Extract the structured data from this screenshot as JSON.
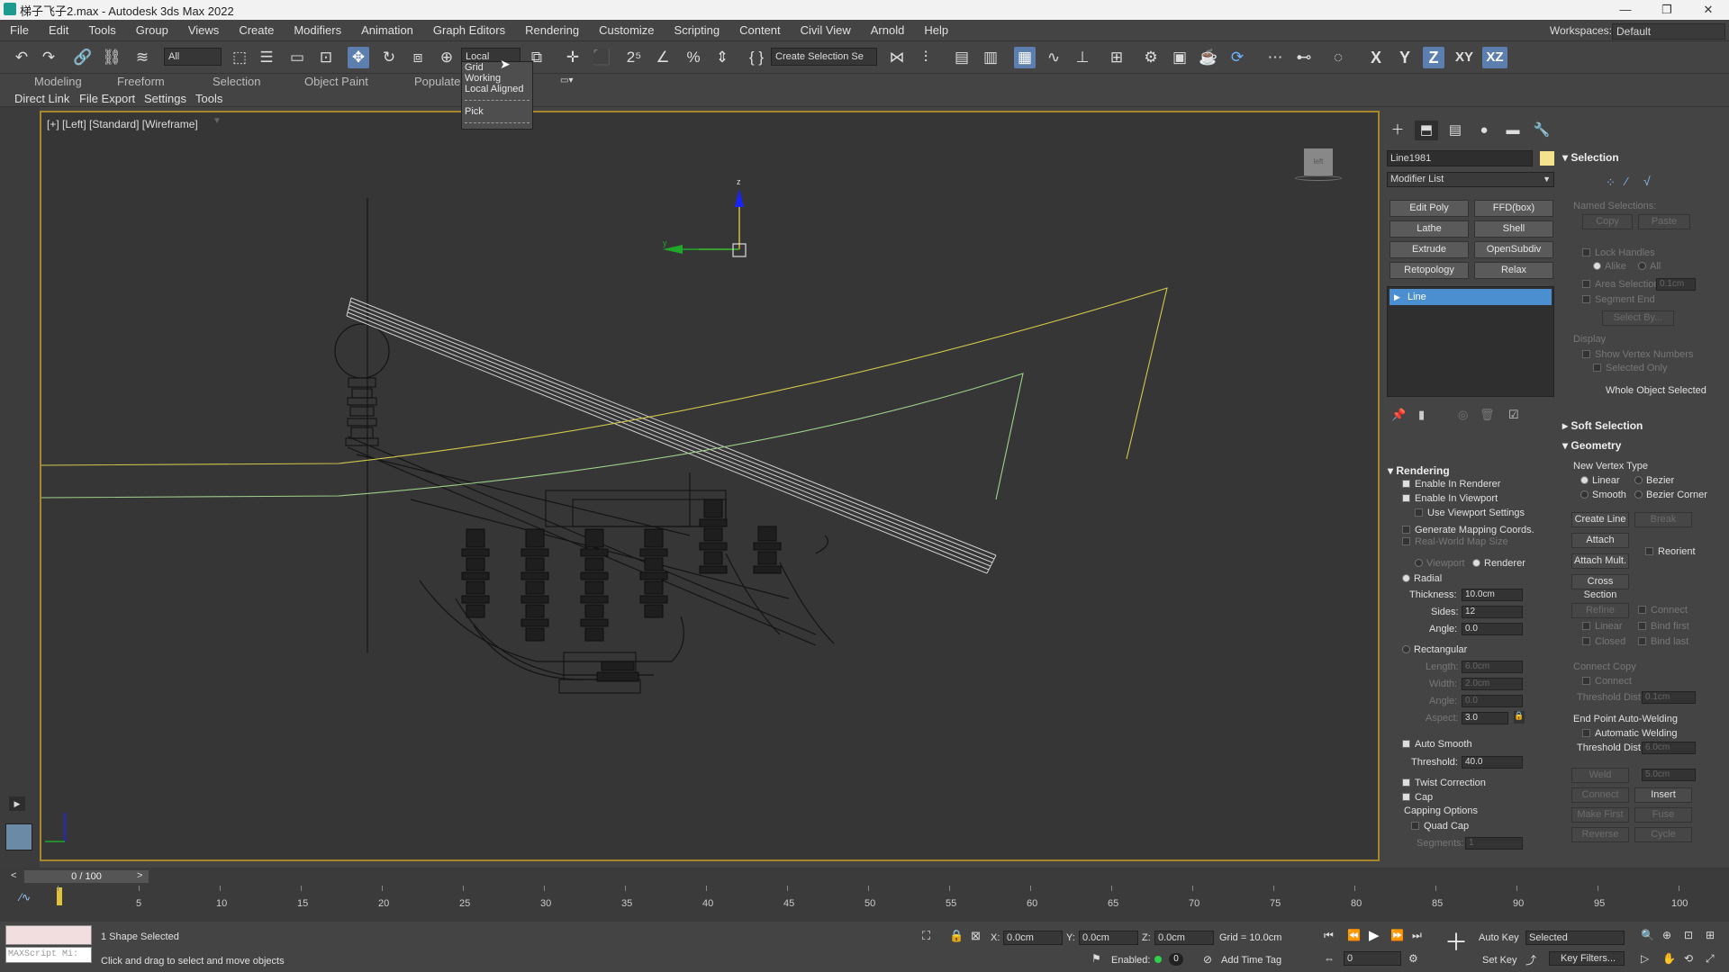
{
  "window": {
    "title": "梯子飞子2.max - Autodesk 3ds Max 2022",
    "minimize": "—",
    "restore": "❐",
    "close": "✕"
  },
  "menu": [
    "File",
    "Edit",
    "Tools",
    "Group",
    "Views",
    "Create",
    "Modifiers",
    "Animation",
    "Graph Editors",
    "Rendering",
    "Customize",
    "Scripting",
    "Content",
    "Civil View",
    "Arnold",
    "Help"
  ],
  "workspace": {
    "label": "Workspaces:",
    "value": "Default"
  },
  "toolbar": {
    "filter": "All",
    "coord_system": "Local",
    "selection_set": "Create Selection Se",
    "axis_x": "X",
    "axis_y": "Y",
    "axis_z": "Z",
    "axis_xy": "XY",
    "axis_xz": "XZ"
  },
  "coord_dropdown": [
    "Grid",
    "Working",
    "Local Aligned",
    "Pick"
  ],
  "ribbon": [
    "Modeling",
    "Freeform",
    "Selection",
    "Object Paint",
    "Populate"
  ],
  "subbar": [
    "Direct Link",
    "File Export",
    "Settings",
    "Tools"
  ],
  "viewport": {
    "label": "[+] [Left] [Standard] [Wireframe]",
    "cube": "left",
    "axis_z": "z",
    "axis_y": "y"
  },
  "command_panel": {
    "object_name": "Line1981",
    "object_color": "#f5e28c",
    "modifier_list": "Modifier List",
    "modifier_buttons": [
      "Edit Poly",
      "FFD(box)",
      "Lathe",
      "Shell",
      "Extrude",
      "OpenSubdiv",
      "Retopology",
      "Relax"
    ],
    "stack_item": "Line",
    "rendering": {
      "title": "Rendering",
      "enable_renderer": "Enable In Renderer",
      "enable_viewport": "Enable In Viewport",
      "use_viewport": "Use Viewport Settings",
      "gen_mapping": "Generate Mapping Coords.",
      "real_world": "Real-World Map Size",
      "viewport": "Viewport",
      "renderer": "Renderer",
      "radial": "Radial",
      "thickness_label": "Thickness:",
      "thickness": "10.0cm",
      "sides_label": "Sides:",
      "sides": "12",
      "angle_label": "Angle:",
      "angle": "0.0",
      "rectangular": "Rectangular",
      "length_label": "Length:",
      "length": "6.0cm",
      "width_label": "Width:",
      "width": "2.0cm",
      "angle2_label": "Angle:",
      "angle2": "0.0",
      "aspect_label": "Aspect:",
      "aspect": "3.0",
      "auto_smooth": "Auto Smooth",
      "threshold_label": "Threshold:",
      "threshold": "40.0",
      "twist": "Twist Correction",
      "cap": "Cap",
      "capping": "Capping Options",
      "quad_cap": "Quad Cap",
      "segments_label": "Segments:",
      "segments": "1"
    },
    "selection": {
      "title": "Selection",
      "named": "Named Selections:",
      "copy": "Copy",
      "paste": "Paste",
      "lock_handles": "Lock Handles",
      "alike": "Alike",
      "all": "All",
      "area_selection": "Area Selection",
      "area_value": "0.1cm",
      "segment_end": "Segment End",
      "select_by": "Select By...",
      "display": "Display",
      "show_vertex": "Show Vertex Numbers",
      "selected_only": "Selected Only",
      "status": "Whole Object Selected"
    },
    "soft_selection": "Soft Selection",
    "geometry": {
      "title": "Geometry",
      "new_vertex": "New Vertex Type",
      "linear": "Linear",
      "bezier": "Bezier",
      "smooth": "Smooth",
      "bezier_corner": "Bezier Corner",
      "create_line": "Create Line",
      "break": "Break",
      "attach": "Attach",
      "reorient": "Reorient",
      "attach_mult": "Attach Mult.",
      "cross_section": "Cross Section",
      "refine": "Refine",
      "connect": "Connect",
      "linear2": "Linear",
      "bind_first": "Bind first",
      "closed": "Closed",
      "bind_last": "Bind last",
      "connect_copy": "Connect Copy",
      "connect2": "Connect",
      "threshold_dist": "Threshold Dist",
      "threshold_val": "0.1cm",
      "end_point": "End Point Auto-Welding",
      "auto_weld": "Automatic Welding",
      "threshold_dist2": "Threshold Dist",
      "threshold_val2": "6.0cm",
      "weld": "Weld",
      "weld_val": "5.0cm",
      "connect3": "Connect",
      "insert": "Insert",
      "make_first": "Make First",
      "fuse": "Fuse",
      "reverse": "Reverse",
      "cycle": "Cycle"
    }
  },
  "timeline": {
    "slider": "0 / 100",
    "ticks": [
      "5",
      "10",
      "15",
      "20",
      "25",
      "30",
      "35",
      "40",
      "45",
      "50",
      "55",
      "60",
      "65",
      "70",
      "75",
      "80",
      "85",
      "90",
      "95",
      "100"
    ]
  },
  "status": {
    "maxscript": "MAXScript Mi:",
    "selection": "1 Shape Selected",
    "prompt": "Click and drag to select and move objects",
    "x_label": "X:",
    "x": "0.0cm",
    "y_label": "Y:",
    "y": "0.0cm",
    "z_label": "Z:",
    "z": "0.0cm",
    "grid": "Grid = 10.0cm",
    "enabled": "Enabled:",
    "enabled_val": "0",
    "add_time_tag": "Add Time Tag",
    "auto_key": "Auto Key",
    "auto_key_mode": "Selected",
    "set_key": "Set Key",
    "key_filters": "Key Filters...",
    "frame": "0"
  }
}
